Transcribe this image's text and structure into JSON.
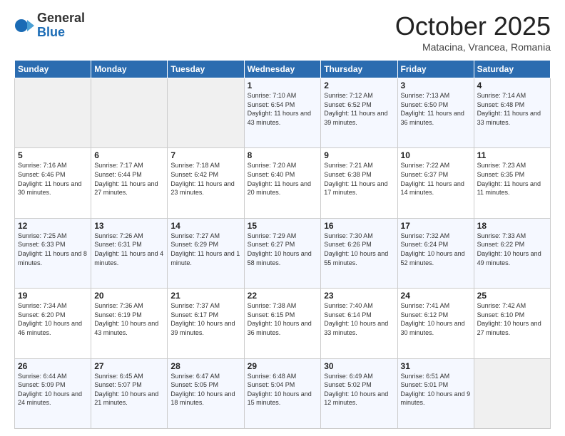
{
  "logo": {
    "general": "General",
    "blue": "Blue"
  },
  "header": {
    "month": "October 2025",
    "location": "Matacina, Vrancea, Romania"
  },
  "weekdays": [
    "Sunday",
    "Monday",
    "Tuesday",
    "Wednesday",
    "Thursday",
    "Friday",
    "Saturday"
  ],
  "weeks": [
    [
      {
        "day": "",
        "info": ""
      },
      {
        "day": "",
        "info": ""
      },
      {
        "day": "",
        "info": ""
      },
      {
        "day": "1",
        "info": "Sunrise: 7:10 AM\nSunset: 6:54 PM\nDaylight: 11 hours and 43 minutes."
      },
      {
        "day": "2",
        "info": "Sunrise: 7:12 AM\nSunset: 6:52 PM\nDaylight: 11 hours and 39 minutes."
      },
      {
        "day": "3",
        "info": "Sunrise: 7:13 AM\nSunset: 6:50 PM\nDaylight: 11 hours and 36 minutes."
      },
      {
        "day": "4",
        "info": "Sunrise: 7:14 AM\nSunset: 6:48 PM\nDaylight: 11 hours and 33 minutes."
      }
    ],
    [
      {
        "day": "5",
        "info": "Sunrise: 7:16 AM\nSunset: 6:46 PM\nDaylight: 11 hours and 30 minutes."
      },
      {
        "day": "6",
        "info": "Sunrise: 7:17 AM\nSunset: 6:44 PM\nDaylight: 11 hours and 27 minutes."
      },
      {
        "day": "7",
        "info": "Sunrise: 7:18 AM\nSunset: 6:42 PM\nDaylight: 11 hours and 23 minutes."
      },
      {
        "day": "8",
        "info": "Sunrise: 7:20 AM\nSunset: 6:40 PM\nDaylight: 11 hours and 20 minutes."
      },
      {
        "day": "9",
        "info": "Sunrise: 7:21 AM\nSunset: 6:38 PM\nDaylight: 11 hours and 17 minutes."
      },
      {
        "day": "10",
        "info": "Sunrise: 7:22 AM\nSunset: 6:37 PM\nDaylight: 11 hours and 14 minutes."
      },
      {
        "day": "11",
        "info": "Sunrise: 7:23 AM\nSunset: 6:35 PM\nDaylight: 11 hours and 11 minutes."
      }
    ],
    [
      {
        "day": "12",
        "info": "Sunrise: 7:25 AM\nSunset: 6:33 PM\nDaylight: 11 hours and 8 minutes."
      },
      {
        "day": "13",
        "info": "Sunrise: 7:26 AM\nSunset: 6:31 PM\nDaylight: 11 hours and 4 minutes."
      },
      {
        "day": "14",
        "info": "Sunrise: 7:27 AM\nSunset: 6:29 PM\nDaylight: 11 hours and 1 minute."
      },
      {
        "day": "15",
        "info": "Sunrise: 7:29 AM\nSunset: 6:27 PM\nDaylight: 10 hours and 58 minutes."
      },
      {
        "day": "16",
        "info": "Sunrise: 7:30 AM\nSunset: 6:26 PM\nDaylight: 10 hours and 55 minutes."
      },
      {
        "day": "17",
        "info": "Sunrise: 7:32 AM\nSunset: 6:24 PM\nDaylight: 10 hours and 52 minutes."
      },
      {
        "day": "18",
        "info": "Sunrise: 7:33 AM\nSunset: 6:22 PM\nDaylight: 10 hours and 49 minutes."
      }
    ],
    [
      {
        "day": "19",
        "info": "Sunrise: 7:34 AM\nSunset: 6:20 PM\nDaylight: 10 hours and 46 minutes."
      },
      {
        "day": "20",
        "info": "Sunrise: 7:36 AM\nSunset: 6:19 PM\nDaylight: 10 hours and 43 minutes."
      },
      {
        "day": "21",
        "info": "Sunrise: 7:37 AM\nSunset: 6:17 PM\nDaylight: 10 hours and 39 minutes."
      },
      {
        "day": "22",
        "info": "Sunrise: 7:38 AM\nSunset: 6:15 PM\nDaylight: 10 hours and 36 minutes."
      },
      {
        "day": "23",
        "info": "Sunrise: 7:40 AM\nSunset: 6:14 PM\nDaylight: 10 hours and 33 minutes."
      },
      {
        "day": "24",
        "info": "Sunrise: 7:41 AM\nSunset: 6:12 PM\nDaylight: 10 hours and 30 minutes."
      },
      {
        "day": "25",
        "info": "Sunrise: 7:42 AM\nSunset: 6:10 PM\nDaylight: 10 hours and 27 minutes."
      }
    ],
    [
      {
        "day": "26",
        "info": "Sunrise: 6:44 AM\nSunset: 5:09 PM\nDaylight: 10 hours and 24 minutes."
      },
      {
        "day": "27",
        "info": "Sunrise: 6:45 AM\nSunset: 5:07 PM\nDaylight: 10 hours and 21 minutes."
      },
      {
        "day": "28",
        "info": "Sunrise: 6:47 AM\nSunset: 5:05 PM\nDaylight: 10 hours and 18 minutes."
      },
      {
        "day": "29",
        "info": "Sunrise: 6:48 AM\nSunset: 5:04 PM\nDaylight: 10 hours and 15 minutes."
      },
      {
        "day": "30",
        "info": "Sunrise: 6:49 AM\nSunset: 5:02 PM\nDaylight: 10 hours and 12 minutes."
      },
      {
        "day": "31",
        "info": "Sunrise: 6:51 AM\nSunset: 5:01 PM\nDaylight: 10 hours and 9 minutes."
      },
      {
        "day": "",
        "info": ""
      }
    ]
  ]
}
